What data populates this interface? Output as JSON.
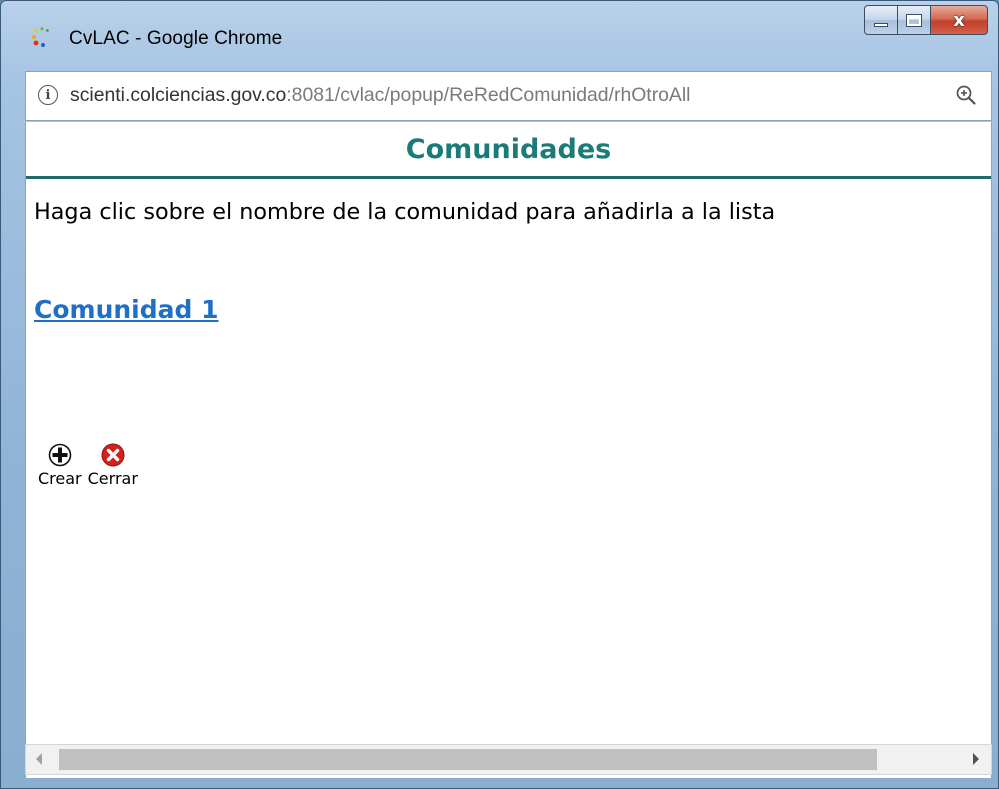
{
  "window": {
    "title": "CvLAC - Google Chrome",
    "icon": "cvlac-favicon-icon",
    "controls": {
      "minimize": "minimize-icon",
      "maximize": "maximize-icon",
      "close": "x"
    }
  },
  "address_bar": {
    "url_host": "scienti.colciencias.gov.co",
    "url_rest": ":8081/cvlac/popup/ReRedComunidad/rhOtroAll",
    "info_icon": "i",
    "zoom_icon": "zoom-icon"
  },
  "page": {
    "title": "Comunidades",
    "instructions": "Haga clic sobre el nombre de la comunidad para añadirla a la lista",
    "communities": [
      {
        "label": "Comunidad 1"
      }
    ],
    "actions": {
      "create_label": "Crear",
      "close_label": "Cerrar"
    }
  },
  "colors": {
    "title": "#1b7b78",
    "link": "#1f6fc6",
    "rule": "#1f6b69"
  }
}
